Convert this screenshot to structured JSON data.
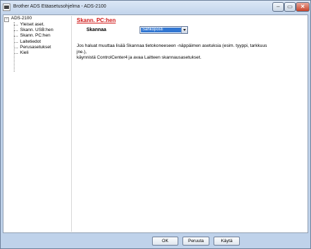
{
  "window": {
    "title": "Brother ADS Etäasetusohjelma - ADS-2100",
    "controls": {
      "minimize": "–",
      "maximize": "▭",
      "close": "✕"
    }
  },
  "tree": {
    "root": {
      "expander": "−",
      "label": "ADS-2100"
    },
    "items": [
      {
        "label": "Yleiset aset."
      },
      {
        "label": "Skann. USB:hen"
      },
      {
        "label": "Skann. PC:hen"
      },
      {
        "label": "Laitetiedot"
      },
      {
        "label": "Perusasetukset"
      },
      {
        "label": "Kieli"
      }
    ]
  },
  "main": {
    "page_title": "Skann. PC:hen",
    "scan_label": "Skannaa",
    "scan_value": "Sähköposti",
    "info_line1": "Jos haluat muuttaa lisää Skannaa tietokoneeseen -näppäimen asetuksia (esim. tyyppi, tarkkuus jne.),",
    "info_line2": "käynnistä ControlCenter4 ja avaa Laitteen skannausasetukset."
  },
  "footer": {
    "ok_label": "OK",
    "cancel_label": "Peruuta",
    "apply_label": "Käytä"
  }
}
